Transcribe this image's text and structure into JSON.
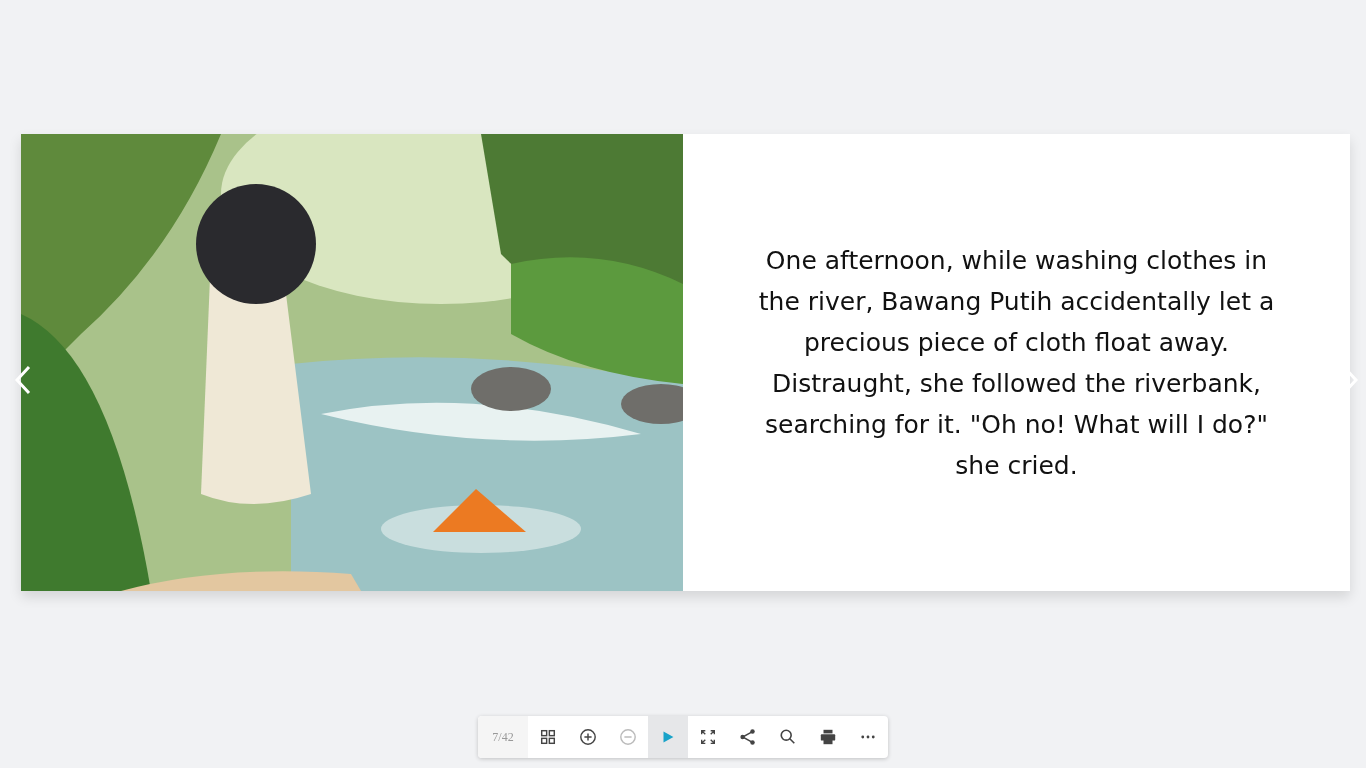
{
  "book": {
    "right_page": {
      "text": "One afternoon, while washing clothes in the river, Bawang Putih accidentally let a precious piece of cloth float away. Distraught, she followed the riverbank, searching for it. \"Oh no! What will I do?\" she cried."
    }
  },
  "toolbar": {
    "page_indicator": "7/42",
    "buttons": [
      {
        "kind": "thumbnails",
        "selected": false,
        "disabled": false
      },
      {
        "kind": "zoom_in",
        "selected": false,
        "disabled": false
      },
      {
        "kind": "zoom_out",
        "selected": false,
        "disabled": true
      },
      {
        "kind": "play",
        "selected": true,
        "disabled": false
      },
      {
        "kind": "fullscreen",
        "selected": false,
        "disabled": false
      },
      {
        "kind": "share",
        "selected": false,
        "disabled": false
      },
      {
        "kind": "search",
        "selected": false,
        "disabled": false
      },
      {
        "kind": "print",
        "selected": false,
        "disabled": false
      },
      {
        "kind": "more",
        "selected": false,
        "disabled": false
      }
    ]
  }
}
